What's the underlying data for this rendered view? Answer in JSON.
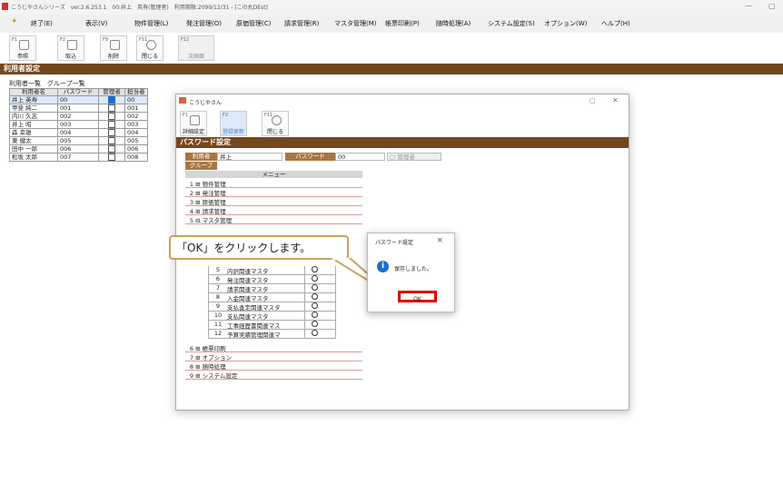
{
  "window": {
    "title": "こうじやさんシリーズ　ver.2.6.253.1　00:井上　英寿(管理者)　利用期限:2099/12/31 - [この丸DEst]"
  },
  "menu": [
    "終了(E)",
    "表示(V)",
    "物件管理(L)",
    "発注管理(O)",
    "原価管理(C)",
    "請求管理(R)",
    "マスタ管理(M)",
    "帳票印刷(P)",
    "随時処理(A)",
    "システム設定(S)",
    "オプション(W)",
    "ヘルプ(H)"
  ],
  "toolbar": [
    {
      "key": "F1",
      "label": "参照"
    },
    {
      "key": "F2",
      "label": "取込"
    },
    {
      "key": "F9",
      "label": "削除"
    },
    {
      "key": "F11",
      "label": "閉じる"
    },
    {
      "key": "F12",
      "label": "次画面"
    }
  ],
  "section_title": "利用者設定",
  "tabs": [
    "利用者一覧",
    "グループ一覧"
  ],
  "user_table": {
    "headers": [
      "利用者名",
      "パスワード",
      "管理者",
      "担当者"
    ],
    "rows": [
      {
        "name": "井上 英寿",
        "pw": "00",
        "admin": true,
        "tan": "00"
      },
      {
        "name": "甲斐 純二",
        "pw": "001",
        "admin": false,
        "tan": "001"
      },
      {
        "name": "内川 久志",
        "pw": "002",
        "admin": false,
        "tan": "002"
      },
      {
        "name": "井上 昭",
        "pw": "003",
        "admin": false,
        "tan": "003"
      },
      {
        "name": "森 幸雄",
        "pw": "004",
        "admin": false,
        "tan": "004"
      },
      {
        "name": "東 健太",
        "pw": "005",
        "admin": false,
        "tan": "005"
      },
      {
        "name": "田中 一郎",
        "pw": "006",
        "admin": false,
        "tan": "006"
      },
      {
        "name": "松坂 太郎",
        "pw": "007",
        "admin": false,
        "tan": "008"
      }
    ]
  },
  "dialog": {
    "title": "こうじやさん",
    "toolbar": [
      {
        "key": "F1",
        "label": "詳細設定"
      },
      {
        "key": "F2",
        "label": "登録更新"
      },
      {
        "key": "F11",
        "label": "閉じる"
      }
    ],
    "section": "パスワード設定",
    "user_label": "利用者",
    "user_value": "井上",
    "pw_label": "パスワード",
    "pw_value": "00",
    "admin_label": "管理者",
    "group_label": "グループ",
    "menu_header": "メニュー",
    "menu_top": [
      {
        "no": "1",
        "name": "物件管理"
      },
      {
        "no": "2",
        "name": "発注管理"
      },
      {
        "no": "3",
        "name": "原価管理"
      },
      {
        "no": "4",
        "name": "請求管理"
      },
      {
        "no": "5",
        "name": "マスタ管理"
      }
    ],
    "sub": [
      {
        "no": "5",
        "name": "内訳関連マスタ"
      },
      {
        "no": "6",
        "name": "発注関連マスタ"
      },
      {
        "no": "7",
        "name": "請求関連マスタ"
      },
      {
        "no": "8",
        "name": "入金関連マスタ"
      },
      {
        "no": "9",
        "name": "支払査定関連マスタ"
      },
      {
        "no": "10",
        "name": "支払関連マスタ"
      },
      {
        "no": "11",
        "name": "工事経歴書関連マス"
      },
      {
        "no": "12",
        "name": "予算実績管理関連マ"
      }
    ],
    "menu_bottom": [
      {
        "no": "6",
        "name": "帳票印刷"
      },
      {
        "no": "7",
        "name": "オプション"
      },
      {
        "no": "8",
        "name": "随時処理"
      },
      {
        "no": "9",
        "name": "システム設定"
      }
    ]
  },
  "callout": "「OK」をクリックします。",
  "alert": {
    "title": "パスワード設定",
    "message": "保存しました。",
    "ok": "OK"
  }
}
